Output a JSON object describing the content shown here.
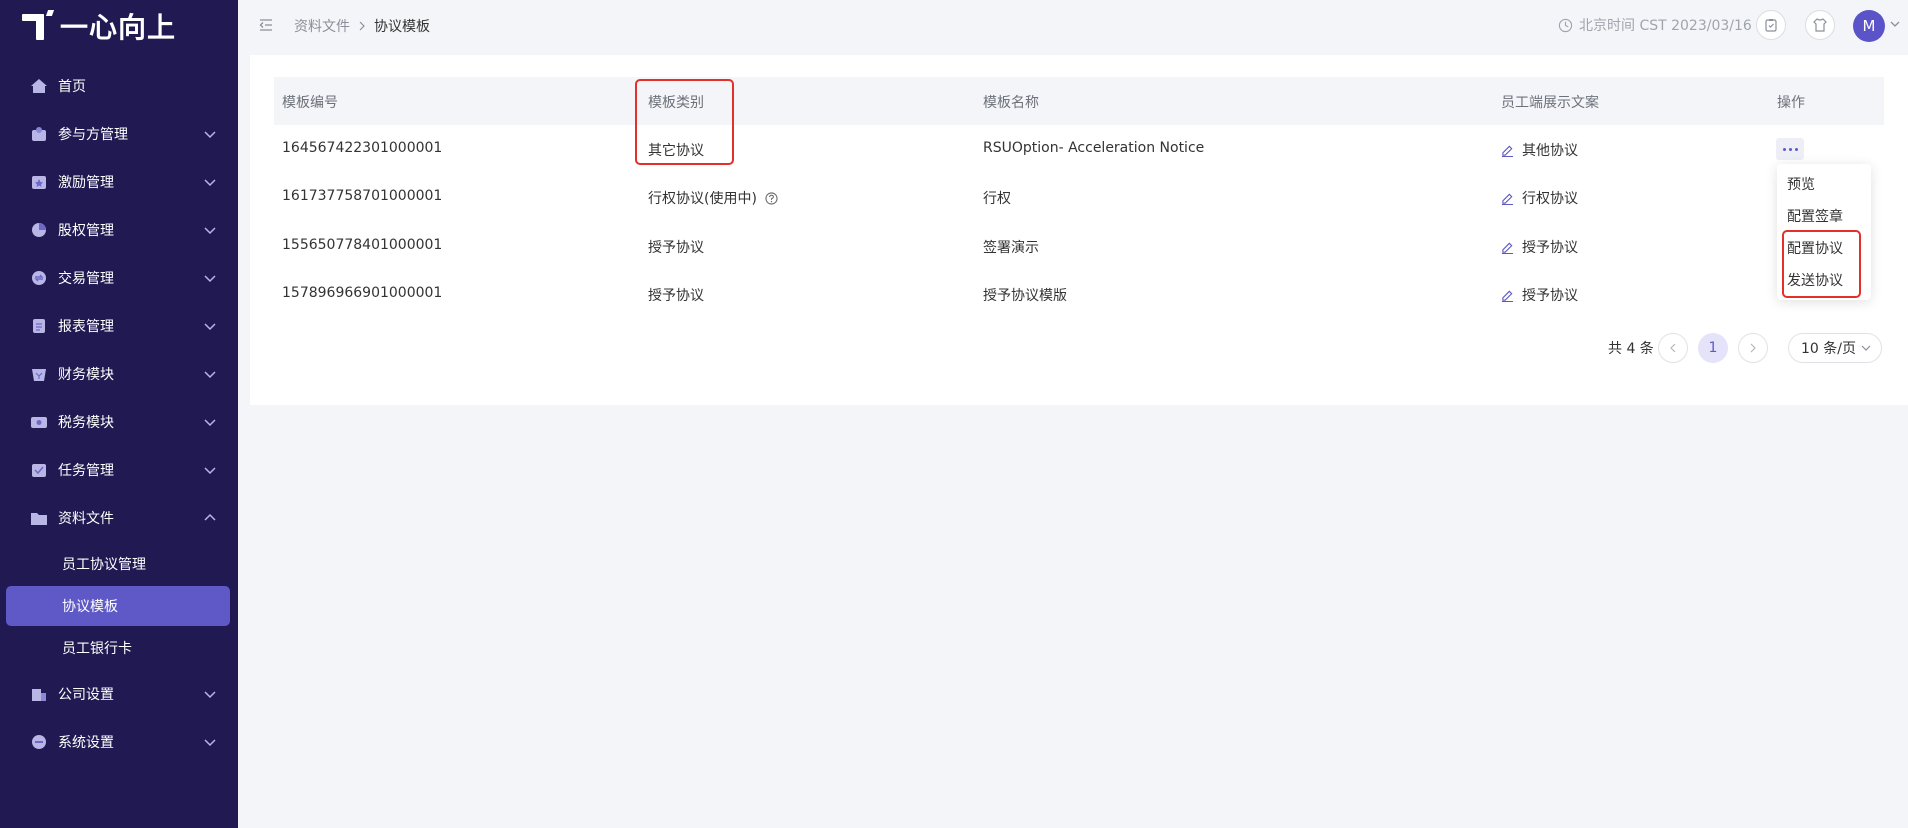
{
  "app": {
    "logo_text": "一心向上"
  },
  "sidebar": {
    "items": [
      {
        "label": "首页",
        "icon": "home-icon",
        "expandable": false
      },
      {
        "label": "参与方管理",
        "icon": "participant-icon",
        "expandable": true
      },
      {
        "label": "激励管理",
        "icon": "incentive-icon",
        "expandable": true
      },
      {
        "label": "股权管理",
        "icon": "equity-icon",
        "expandable": true
      },
      {
        "label": "交易管理",
        "icon": "trade-icon",
        "expandable": true
      },
      {
        "label": "报表管理",
        "icon": "report-icon",
        "expandable": true
      },
      {
        "label": "财务模块",
        "icon": "finance-icon",
        "expandable": true
      },
      {
        "label": "税务模块",
        "icon": "tax-icon",
        "expandable": true
      },
      {
        "label": "任务管理",
        "icon": "task-icon",
        "expandable": true
      },
      {
        "label": "资料文件",
        "icon": "folder-icon",
        "expandable": true,
        "expanded": true
      },
      {
        "label": "公司设置",
        "icon": "company-icon",
        "expandable": true
      },
      {
        "label": "系统设置",
        "icon": "settings-icon",
        "expandable": true
      }
    ],
    "sub_items": [
      {
        "label": "员工协议管理",
        "active": false
      },
      {
        "label": "协议模板",
        "active": true
      },
      {
        "label": "员工银行卡",
        "active": false
      }
    ]
  },
  "header": {
    "breadcrumb": [
      "资料文件",
      "协议模板"
    ],
    "time_text": "北京时间 CST 2023/03/16",
    "avatar_letter": "M"
  },
  "table": {
    "columns": [
      "模板编号",
      "模板类别",
      "模板名称",
      "员工端展示文案",
      "操作"
    ],
    "rows": [
      {
        "id": "164567422301000001",
        "category": "其它协议",
        "name": "RSUOption- Acceleration Notice",
        "display": "其他协议",
        "has_help": false
      },
      {
        "id": "161737758701000001",
        "category": "行权协议(使用中)",
        "name": "行权",
        "display": "行权协议",
        "has_help": true
      },
      {
        "id": "155650778401000001",
        "category": "授予协议",
        "name": "签署演示",
        "display": "授予协议",
        "has_help": false
      },
      {
        "id": "157896966901000001",
        "category": "授予协议",
        "name": "授予协议模版",
        "display": "授予协议",
        "has_help": false
      }
    ]
  },
  "dropdown": {
    "items": [
      "预览",
      "配置签章",
      "配置协议",
      "发送协议"
    ]
  },
  "pagination": {
    "total_text": "共 4 条",
    "current_page": "1",
    "page_size": "10 条/页"
  },
  "colors": {
    "sidebar_bg": "#211a52",
    "accent": "#5e59c7",
    "highlight": "#e3302b"
  }
}
